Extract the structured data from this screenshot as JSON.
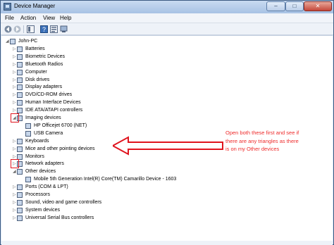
{
  "window": {
    "title": "Device Manager",
    "close_glyph": "✕",
    "min_glyph": "–",
    "max_glyph": "□"
  },
  "menu": [
    "File",
    "Action",
    "View",
    "Help"
  ],
  "toolbar": [
    "back-icon",
    "forward-icon",
    "show-hide-tree-icon",
    "help-icon",
    "properties-icon"
  ],
  "tree": {
    "root": "John-PC",
    "items": [
      {
        "label": "Batteries",
        "icon": "battery-icon",
        "exp": "▷"
      },
      {
        "label": "Biometric Devices",
        "icon": "biometric-icon",
        "exp": "▷"
      },
      {
        "label": "Bluetooth Radios",
        "icon": "bluetooth-icon",
        "exp": "▷"
      },
      {
        "label": "Computer",
        "icon": "computer-icon",
        "exp": "▷"
      },
      {
        "label": "Disk drives",
        "icon": "disk-drive-icon",
        "exp": "▷"
      },
      {
        "label": "Display adapters",
        "icon": "display-adapter-icon",
        "exp": "▷"
      },
      {
        "label": "DVD/CD-ROM drives",
        "icon": "dvd-drive-icon",
        "exp": "▷"
      },
      {
        "label": "Human Interface Devices",
        "icon": "hid-icon",
        "exp": "▷"
      },
      {
        "label": "IDE ATA/ATAPI controllers",
        "icon": "ide-controller-icon",
        "exp": "▷"
      },
      {
        "label": "Imaging devices",
        "icon": "camera-icon",
        "exp": "◢",
        "children": [
          "HP Officejet 6700 (NET)",
          "USB Camera"
        ]
      },
      {
        "label": "Keyboards",
        "icon": "keyboard-icon",
        "exp": "▷"
      },
      {
        "label": "Mice and other pointing devices",
        "icon": "mouse-icon",
        "exp": "▷"
      },
      {
        "label": "Monitors",
        "icon": "monitor-icon",
        "exp": "▷"
      },
      {
        "label": "Network adapters",
        "icon": "network-adapter-icon",
        "exp": "▷"
      },
      {
        "label": "Other devices",
        "icon": "unknown-device-icon",
        "exp": "◢",
        "children": [
          "Mobile 5th Generation Intel(R) Core(TM) Camarillo Device - 1603"
        ]
      },
      {
        "label": "Ports (COM & LPT)",
        "icon": "port-icon",
        "exp": "▷"
      },
      {
        "label": "Processors",
        "icon": "processor-icon",
        "exp": "▷"
      },
      {
        "label": "Sound, video and game controllers",
        "icon": "sound-icon",
        "exp": "▷"
      },
      {
        "label": "System devices",
        "icon": "system-device-icon",
        "exp": "▷"
      },
      {
        "label": "Universal Serial Bus controllers",
        "icon": "usb-icon",
        "exp": "▷"
      }
    ]
  },
  "annotation": {
    "text": "Open both these first and see if there are any triangles as there is on my Other devices",
    "color": "#e0141e"
  }
}
